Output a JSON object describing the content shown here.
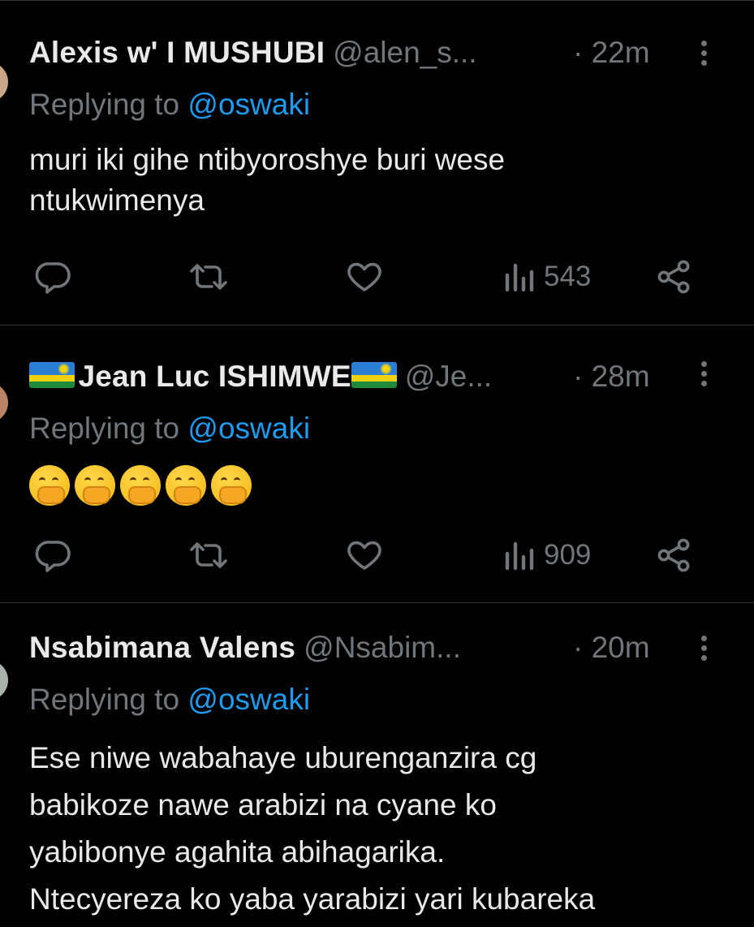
{
  "tweets": [
    {
      "name": "Alexis w' I MUSHUBI",
      "handle": "@alen_s...",
      "time": "· 22m",
      "replying_prefix": "Replying to",
      "replying_handle": "@oswaki",
      "body": "muri iki gihe ntibyoroshye buri wese ntukwimenya",
      "views": "543",
      "avatar_color": "#c9a58a"
    },
    {
      "name": "Jean Luc ISHIMWE",
      "handle": "@Je...",
      "time": "· 28m",
      "replying_prefix": "Replying to",
      "replying_handle": "@oswaki",
      "body_emoji_count": 5,
      "body_emoji": "face-with-hand-over-mouth",
      "views": "909",
      "avatar_color": "#b98466"
    },
    {
      "name": "Nsabimana Valens",
      "handle": "@Nsabim...",
      "time": "· 20m",
      "replying_prefix": "Replying to",
      "replying_handle": "@oswaki",
      "body_lines": [
        "Ese niwe wabahaye uburenganzira cg",
        "babikoze nawe arabizi na cyane ko",
        "yabibonye agahita abihagarika.",
        "Ntecyereza ko yaba yarabizi yari kubareka"
      ],
      "avatar_color": "#a9b3ab"
    }
  ],
  "colors": {
    "background": "#000000",
    "text": "#e7e9ea",
    "muted": "#71767b",
    "link": "#1d9bf0",
    "divider": "#2f3336"
  },
  "icons": [
    "reply-icon",
    "retweet-icon",
    "like-icon",
    "views-icon",
    "share-icon",
    "more-icon"
  ]
}
